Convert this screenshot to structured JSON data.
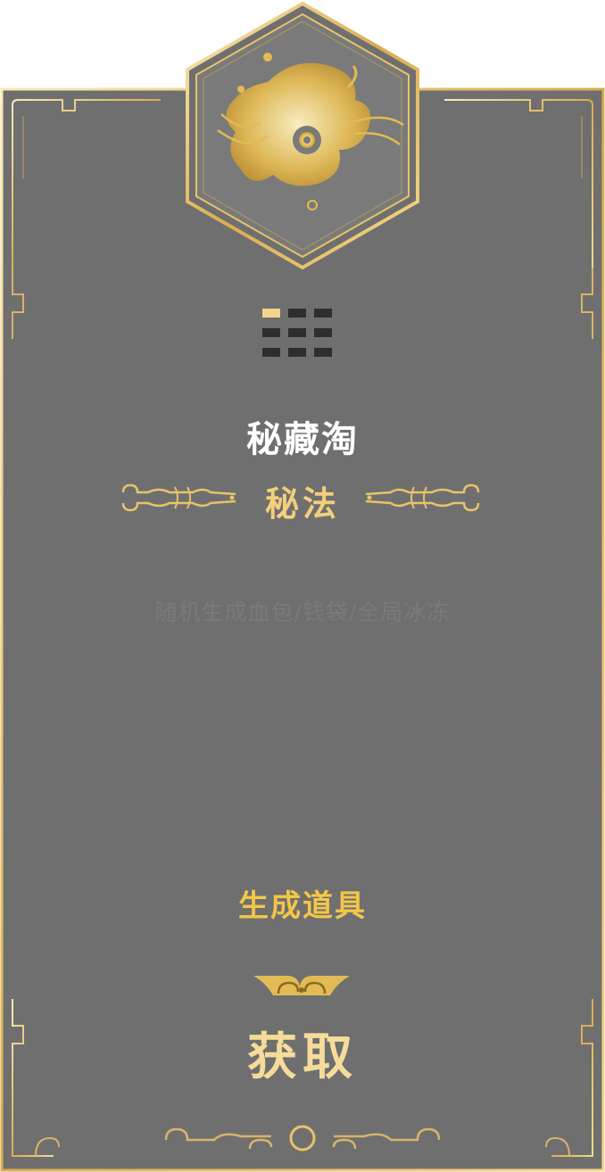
{
  "card": {
    "level": {
      "total": 9,
      "active": 1
    },
    "title": "秘藏淘",
    "type_label": "秘法",
    "description": "随机生成血包/钱袋/全局冰冻",
    "category": "生成道具",
    "action_label": "获取",
    "emblem_icon": "golden-cloud-swirl-icon"
  },
  "colors": {
    "card_bg": "#6f6f6f",
    "gold": "#e6c46a",
    "title": "#ffffff",
    "type_label": "#f2cf7d",
    "category": "#f2c649",
    "description": "#7a7a7a",
    "level_on": "#f2d48e",
    "level_off": "#2e2e2e"
  }
}
